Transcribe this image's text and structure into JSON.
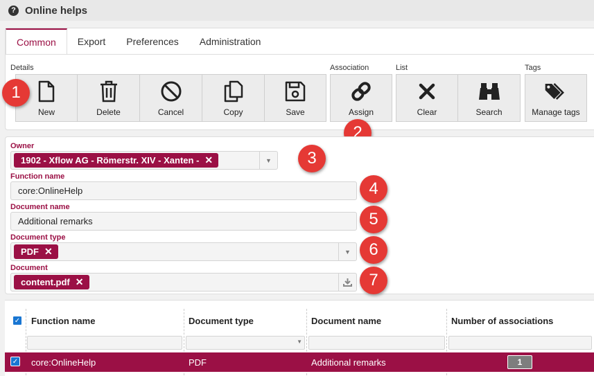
{
  "window": {
    "title": "Online helps",
    "help_icon": "question-circle-icon"
  },
  "tabs": [
    {
      "label": "Common",
      "active": true
    },
    {
      "label": "Export"
    },
    {
      "label": "Preferences"
    },
    {
      "label": "Administration"
    }
  ],
  "toolbar": {
    "groups": {
      "details": "Details",
      "association": "Association",
      "list": "List",
      "tags": "Tags"
    },
    "buttons": {
      "new": {
        "label": "New",
        "icon": "file-icon"
      },
      "delete": {
        "label": "Delete",
        "icon": "trash-icon"
      },
      "cancel": {
        "label": "Cancel",
        "icon": "ban-icon"
      },
      "copy": {
        "label": "Copy",
        "icon": "copy-icon"
      },
      "save": {
        "label": "Save",
        "icon": "floppy-icon"
      },
      "assign": {
        "label": "Assign",
        "icon": "link-icon"
      },
      "clear": {
        "label": "Clear",
        "icon": "x-icon"
      },
      "search": {
        "label": "Search",
        "icon": "binoculars-icon"
      },
      "manage_tags": {
        "label": "Manage tags",
        "icon": "tags-icon"
      }
    }
  },
  "callouts": [
    "1",
    "2",
    "3",
    "4",
    "5",
    "6",
    "7"
  ],
  "form": {
    "owner": {
      "label": "Owner",
      "value": "1902 - Xflow AG - Römerstr. XIV - Xanten -"
    },
    "function_name": {
      "label": "Function name",
      "value": "core:OnlineHelp"
    },
    "document_name": {
      "label": "Document name",
      "value": "Additional remarks"
    },
    "document_type": {
      "label": "Document type",
      "value": "PDF"
    },
    "document": {
      "label": "Document",
      "value": "content.pdf"
    }
  },
  "grid": {
    "columns": [
      "Function name",
      "Document type",
      "Document name",
      "Number of associations"
    ],
    "rows": [
      {
        "function_name": "core:OnlineHelp",
        "document_type": "PDF",
        "document_name": "Additional remarks",
        "associations": "1",
        "selected": true
      }
    ]
  },
  "colors": {
    "accent": "#9b1045",
    "callout": "#e53935",
    "checkbox": "#1976d2"
  }
}
